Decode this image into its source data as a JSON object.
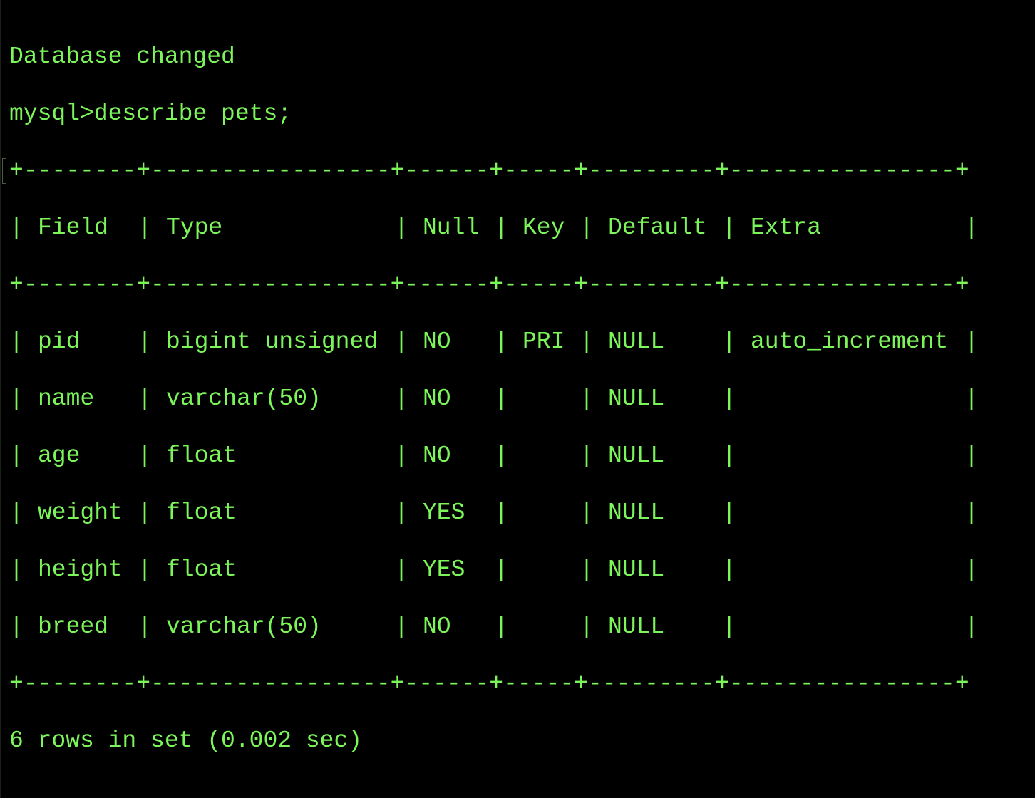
{
  "terminal": {
    "text_color": "#7cf55a",
    "background": "#000000",
    "status_line": "Database changed",
    "prompt": "mysql>",
    "command": "describe pets;",
    "border": "+--------+-----------------+------+-----+---------+----------------+",
    "separator": "|",
    "result_summary": "6 rows in set (0.002 sec)"
  },
  "table": {
    "column_widths": [
      8,
      17,
      6,
      5,
      9,
      16
    ],
    "headers": [
      "Field",
      "Type",
      "Null",
      "Key",
      "Default",
      "Extra"
    ],
    "rows": [
      [
        "pid",
        "bigint unsigned",
        "NO",
        "PRI",
        "NULL",
        "auto_increment"
      ],
      [
        "name",
        "varchar(50)",
        "NO",
        "",
        "NULL",
        ""
      ],
      [
        "age",
        "float",
        "NO",
        "",
        "NULL",
        ""
      ],
      [
        "weight",
        "float",
        "YES",
        "",
        "NULL",
        ""
      ],
      [
        "height",
        "float",
        "YES",
        "",
        "NULL",
        ""
      ],
      [
        "breed",
        "varchar(50)",
        "NO",
        "",
        "NULL",
        ""
      ]
    ]
  }
}
